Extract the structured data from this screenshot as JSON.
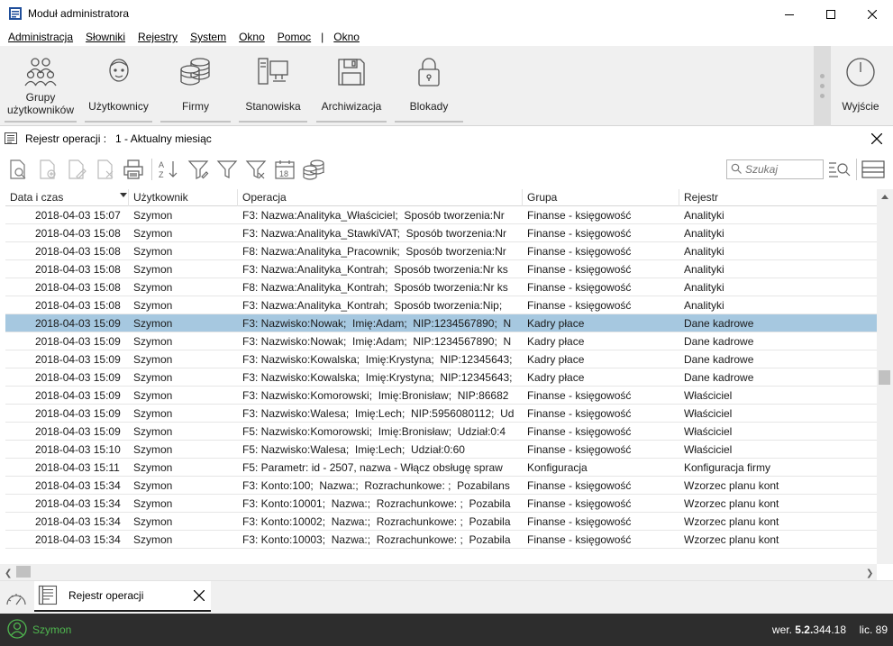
{
  "window": {
    "title": "Moduł administratora"
  },
  "menu": {
    "items": [
      {
        "label": "Administracja"
      },
      {
        "label": "Słowniki"
      },
      {
        "label": "Rejestry"
      },
      {
        "label": "System"
      },
      {
        "label": "Okno"
      },
      {
        "label": "Pomoc"
      }
    ],
    "separator": "|",
    "extra": "Okno"
  },
  "ribbon": {
    "buttons": [
      {
        "label": "Grupy użytkowników",
        "icon": "users-group-icon"
      },
      {
        "label": "Użytkownicy",
        "icon": "user-icon"
      },
      {
        "label": "Firmy",
        "icon": "database-icon"
      },
      {
        "label": "Stanowiska",
        "icon": "workstation-icon"
      },
      {
        "label": "Archiwizacja",
        "icon": "floppy-disk-icon"
      },
      {
        "label": "Blokady",
        "icon": "lock-icon"
      }
    ],
    "exit_label": "Wyjście"
  },
  "panel": {
    "title": "Rejestr operacji :   1 - Aktualny miesiąc"
  },
  "toolbar": {
    "search_placeholder": "Szukaj"
  },
  "grid": {
    "columns": [
      "Data i czas",
      "Użytkownik",
      "Operacja",
      "Grupa",
      "Rejestr"
    ],
    "selected_index": 6,
    "rows": [
      {
        "date": "2018-04-03 15:07",
        "user": "Szymon",
        "op": "F3: Nazwa:Analityka_Właściciel;  Sposób tworzenia:Nr",
        "group": "Finanse - księgowość",
        "reg": "Analityki"
      },
      {
        "date": "2018-04-03 15:08",
        "user": "Szymon",
        "op": "F3: Nazwa:Analityka_StawkiVAT;  Sposób tworzenia:Nr",
        "group": "Finanse - księgowość",
        "reg": "Analityki"
      },
      {
        "date": "2018-04-03 15:08",
        "user": "Szymon",
        "op": "F8: Nazwa:Analityka_Pracownik;  Sposób tworzenia:Nr",
        "group": "Finanse - księgowość",
        "reg": "Analityki"
      },
      {
        "date": "2018-04-03 15:08",
        "user": "Szymon",
        "op": "F3: Nazwa:Analityka_Kontrah;  Sposób tworzenia:Nr ks",
        "group": "Finanse - księgowość",
        "reg": "Analityki"
      },
      {
        "date": "2018-04-03 15:08",
        "user": "Szymon",
        "op": "F8: Nazwa:Analityka_Kontrah;  Sposób tworzenia:Nr ks",
        "group": "Finanse - księgowość",
        "reg": "Analityki"
      },
      {
        "date": "2018-04-03 15:08",
        "user": "Szymon",
        "op": "F3: Nazwa:Analityka_Kontrah;  Sposób tworzenia:Nip;",
        "group": "Finanse - księgowość",
        "reg": "Analityki"
      },
      {
        "date": "2018-04-03 15:09",
        "user": "Szymon",
        "op": "F3: Nazwisko:Nowak;  Imię:Adam;  NIP:1234567890;  N",
        "group": "Kadry płace",
        "reg": "Dane kadrowe"
      },
      {
        "date": "2018-04-03 15:09",
        "user": "Szymon",
        "op": "F3: Nazwisko:Nowak;  Imię:Adam;  NIP:1234567890;  N",
        "group": "Kadry płace",
        "reg": "Dane kadrowe"
      },
      {
        "date": "2018-04-03 15:09",
        "user": "Szymon",
        "op": "F3: Nazwisko:Kowalska;  Imię:Krystyna;  NIP:12345643;",
        "group": "Kadry płace",
        "reg": "Dane kadrowe"
      },
      {
        "date": "2018-04-03 15:09",
        "user": "Szymon",
        "op": "F3: Nazwisko:Kowalska;  Imię:Krystyna;  NIP:12345643;",
        "group": "Kadry płace",
        "reg": "Dane kadrowe"
      },
      {
        "date": "2018-04-03 15:09",
        "user": "Szymon",
        "op": "F3: Nazwisko:Komorowski;  Imię:Bronisław;  NIP:86682",
        "group": "Finanse - księgowość",
        "reg": "Właściciel"
      },
      {
        "date": "2018-04-03 15:09",
        "user": "Szymon",
        "op": "F3: Nazwisko:Walesa;  Imię:Lech;  NIP:5956080112;  Ud",
        "group": "Finanse - księgowość",
        "reg": "Właściciel"
      },
      {
        "date": "2018-04-03 15:09",
        "user": "Szymon",
        "op": "F5: Nazwisko:Komorowski;  Imię:Bronisław;  Udział:0:4",
        "group": "Finanse - księgowość",
        "reg": "Właściciel"
      },
      {
        "date": "2018-04-03 15:10",
        "user": "Szymon",
        "op": "F5: Nazwisko:Walesa;  Imię:Lech;  Udział:0:60",
        "group": "Finanse - księgowość",
        "reg": "Właściciel"
      },
      {
        "date": "2018-04-03 15:11",
        "user": "Szymon",
        "op": "F5: Parametr: id - 2507, nazwa - Włącz obsługę spraw",
        "group": "Konfiguracja",
        "reg": "Konfiguracja firmy"
      },
      {
        "date": "2018-04-03 15:34",
        "user": "Szymon",
        "op": "F3: Konto:100;  Nazwa:;  Rozrachunkowe: ;  Pozabilans",
        "group": "Finanse - księgowość",
        "reg": "Wzorzec planu kont"
      },
      {
        "date": "2018-04-03 15:34",
        "user": "Szymon",
        "op": "F3: Konto:10001;  Nazwa:;  Rozrachunkowe: ;  Pozabila",
        "group": "Finanse - księgowość",
        "reg": "Wzorzec planu kont"
      },
      {
        "date": "2018-04-03 15:34",
        "user": "Szymon",
        "op": "F3: Konto:10002;  Nazwa:;  Rozrachunkowe: ;  Pozabila",
        "group": "Finanse - księgowość",
        "reg": "Wzorzec planu kont"
      },
      {
        "date": "2018-04-03 15:34",
        "user": "Szymon",
        "op": "F3: Konto:10003;  Nazwa:;  Rozrachunkowe: ;  Pozabila",
        "group": "Finanse - księgowość",
        "reg": "Wzorzec planu kont"
      }
    ]
  },
  "tabs": {
    "active_label": "Rejestr operacji"
  },
  "status": {
    "user": "Szymon",
    "version_prefix": "wer.",
    "version": "5.2.",
    "version_build": "344.18",
    "license": "lic. 89"
  },
  "colors": {
    "selection": "#a6c8e0",
    "status_bg": "#2d2d2d",
    "status_user": "#4fb74f"
  }
}
